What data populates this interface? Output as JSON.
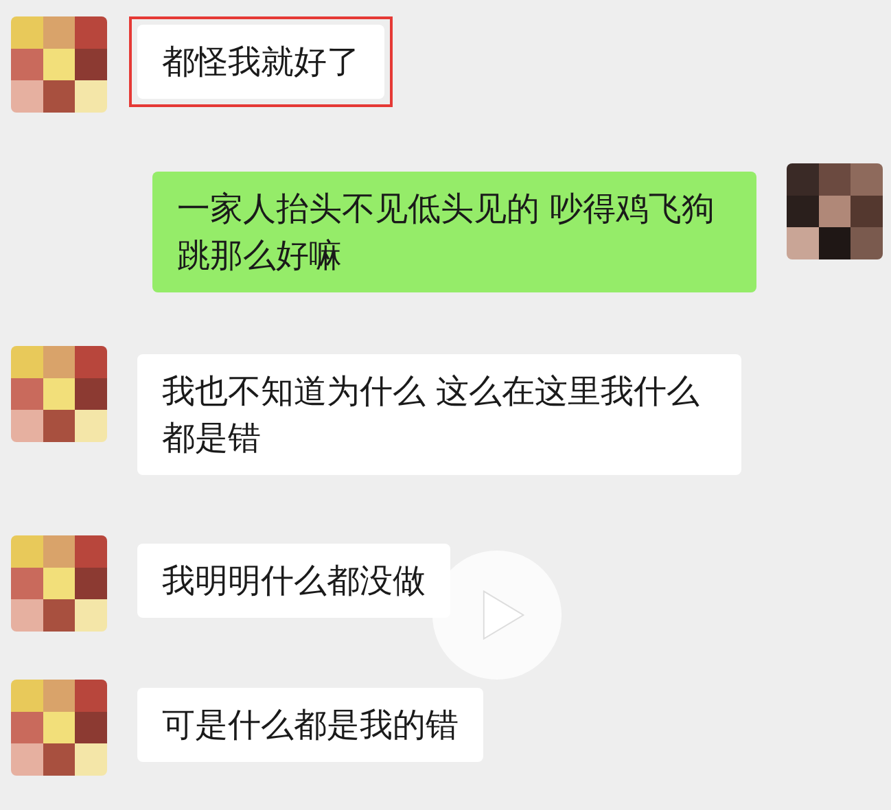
{
  "messages": [
    {
      "kind": "incoming",
      "text": "都怪我就好了",
      "highlighted": true
    },
    {
      "kind": "outgoing",
      "text": "一家人抬头不见低头见的 吵得鸡飞狗跳那么好嘛",
      "highlighted": false
    },
    {
      "kind": "incoming",
      "text": "我也不知道为什么 这么在这里我什么都是错",
      "highlighted": false
    },
    {
      "kind": "incoming",
      "text": "我明明什么都没做",
      "highlighted": false
    },
    {
      "kind": "incoming",
      "text": "可是什么都是我的错",
      "highlighted": false
    }
  ]
}
